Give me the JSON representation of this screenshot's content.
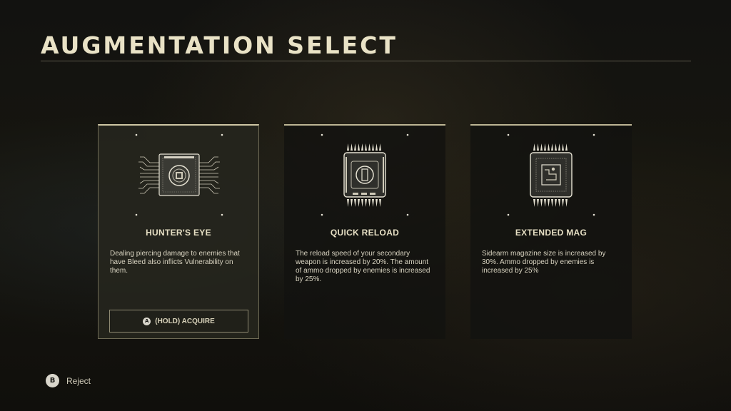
{
  "screen_title": "AUGMENTATION SELECT",
  "cards": [
    {
      "name": "HUNTER'S EYE",
      "description": "Dealing piercing damage to enemies that have Bleed also inflicts Vulnerability on them.",
      "icon": "chip-circuit-icon",
      "selected": true
    },
    {
      "name": "QUICK RELOAD",
      "description": "The reload speed of your secondary weapon is increased by 20%. The amount of ammo dropped by enemies is increased by 25%.",
      "icon": "chip-spiked-icon",
      "selected": false
    },
    {
      "name": "EXTENDED MAG",
      "description": "Sidearm magazine size is increased by 30%. Ammo dropped by enemies is increased by 25%",
      "icon": "chip-spiked-icon",
      "selected": false
    }
  ],
  "acquire": {
    "button_glyph": "A",
    "label": "(HOLD) ACQUIRE"
  },
  "footer": {
    "button_glyph": "B",
    "label": "Reject"
  },
  "colors": {
    "accent": "#e9e2c6",
    "text": "#d8d3c0",
    "card_border": "#bdb594"
  }
}
